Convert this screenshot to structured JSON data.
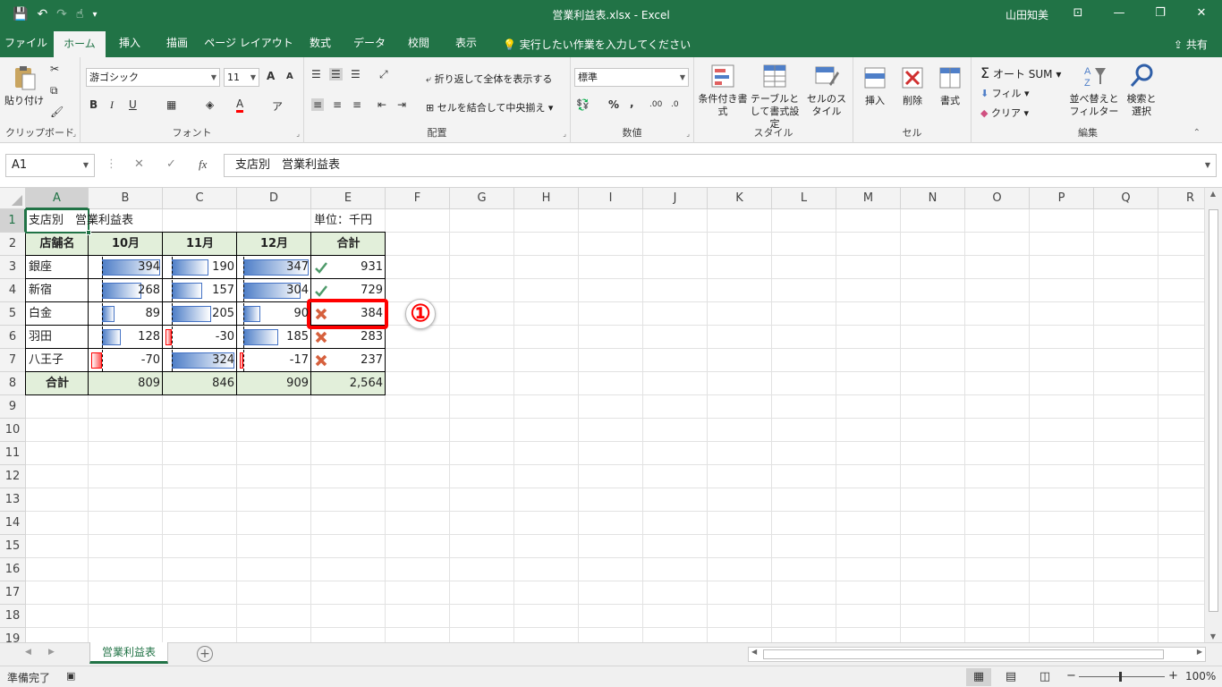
{
  "window": {
    "title": "営業利益表.xlsx  -  Excel",
    "user": "山田知美",
    "qat": {
      "save": "💾",
      "undo": "↶",
      "redo": "↷",
      "touch": "☝",
      "customize": "▾"
    },
    "controls": {
      "ribbon_display": "⊡",
      "minimize": "—",
      "restore": "❐",
      "close": "✕"
    }
  },
  "tabs": [
    {
      "label": "ファイル"
    },
    {
      "label": "ホーム"
    },
    {
      "label": "挿入"
    },
    {
      "label": "描画"
    },
    {
      "label": "ページ レイアウト"
    },
    {
      "label": "数式"
    },
    {
      "label": "データ"
    },
    {
      "label": "校閲"
    },
    {
      "label": "表示"
    }
  ],
  "tell_me": "実行したい作業を入力してください",
  "share": "共有",
  "ribbon": {
    "clipboard": {
      "label": "クリップボード",
      "paste": "貼り付け"
    },
    "font": {
      "label": "フォント",
      "name": "游ゴシック",
      "size": "11",
      "bold": "B",
      "italic": "I",
      "underline": "U",
      "grow": "A",
      "shrink": "A",
      "color_letter": "A"
    },
    "alignment": {
      "label": "配置",
      "wrap": "折り返して全体を表示する",
      "merge": "セルを結合して中央揃え"
    },
    "number": {
      "label": "数値",
      "format": "標準",
      "percent": "%",
      "comma": ","
    },
    "styles": {
      "label": "スタイル",
      "conditional": "条件付き書式",
      "as_table": "テーブルとして書式設定",
      "cell_styles": "セルのスタイル"
    },
    "cells": {
      "label": "セル",
      "insert": "挿入",
      "delete": "削除",
      "format": "書式"
    },
    "editing": {
      "label": "編集",
      "autosum": "オート SUM",
      "fill": "フィル",
      "clear": "クリア",
      "sort": "並べ替えとフィルター",
      "find": "検索と選択",
      "sigma": "Σ"
    }
  },
  "formula_bar": {
    "name_box": "A1",
    "cancel": "✕",
    "enter": "✓",
    "fx": "fx",
    "content": "支店別　営業利益表"
  },
  "grid": {
    "columns": [
      "A",
      "B",
      "C",
      "D",
      "E",
      "F",
      "G",
      "H",
      "I",
      "J",
      "K",
      "L",
      "M",
      "N",
      "O",
      "P",
      "Q",
      "R"
    ],
    "rows": [
      "1",
      "2",
      "3",
      "4",
      "5",
      "6",
      "7",
      "8",
      "9",
      "10",
      "11",
      "12",
      "13",
      "14",
      "15",
      "16",
      "17",
      "18",
      "19"
    ],
    "a1": "支店別　営業利益表",
    "unit": "単位：千円",
    "headers": [
      "店舗名",
      "10月",
      "11月",
      "12月",
      "合計"
    ],
    "data": [
      {
        "store": "銀座",
        "v": [
          "394",
          "190",
          "347"
        ],
        "total": "931",
        "icon": "check"
      },
      {
        "store": "新宿",
        "v": [
          "268",
          "157",
          "304"
        ],
        "total": "729",
        "icon": "check"
      },
      {
        "store": "白金",
        "v": [
          "89",
          "205",
          "90"
        ],
        "total": "384",
        "icon": "cross"
      },
      {
        "store": "羽田",
        "v": [
          "128",
          "-30",
          "185"
        ],
        "total": "283",
        "icon": "cross"
      },
      {
        "store": "八王子",
        "v": [
          "-70",
          "324",
          "-17"
        ],
        "total": "237",
        "icon": "cross"
      }
    ],
    "totals": {
      "label": "合計",
      "v": [
        "809",
        "846",
        "909"
      ],
      "total": "2,564"
    }
  },
  "callout_badge": "①",
  "sheet_tab": "営業利益表",
  "add_sheet": "+",
  "status": {
    "ready": "準備完了",
    "zoom": "100%",
    "zoom_out": "−",
    "zoom_in": "+"
  },
  "colors": {
    "accent": "#217346",
    "header_fill": "#e2efda",
    "bar_positive": "#4f7fc8",
    "bar_negative": "#ff5050",
    "callout": "#ff0000",
    "check": "#4e9a6a",
    "cross": "#d6603d"
  }
}
